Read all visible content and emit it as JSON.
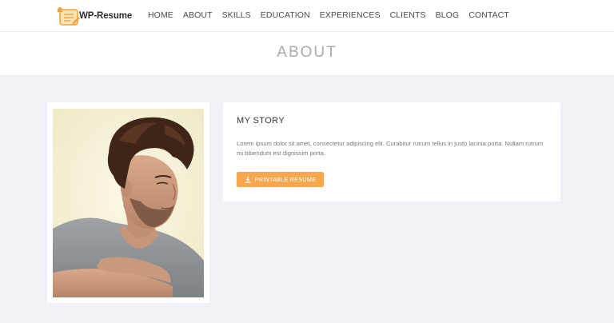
{
  "brand": {
    "name": "WP-Resume"
  },
  "nav": {
    "items": [
      {
        "label": "HOME"
      },
      {
        "label": "ABOUT"
      },
      {
        "label": "SKILLS"
      },
      {
        "label": "EDUCATION"
      },
      {
        "label": "EXPERIENCES"
      },
      {
        "label": "CLIENTS"
      },
      {
        "label": "BLOG"
      },
      {
        "label": "CONTACT"
      }
    ]
  },
  "header": {
    "title": "ABOUT"
  },
  "about": {
    "story_title": "MY STORY",
    "story_text": "Lorem ipsum dolor sit amet, consectetur adipiscing elit. Curabitur rutrum tellus in justo lacinia porta. Nullam rutrum mi bibendum est dignissim porta.",
    "resume_button_label": "PRINTABLE RESUME",
    "resume_button_icon": "download-icon"
  },
  "colors": {
    "accent": "#f7a84f",
    "background": "#f1f2f7",
    "title_gray": "#a9abb0"
  }
}
